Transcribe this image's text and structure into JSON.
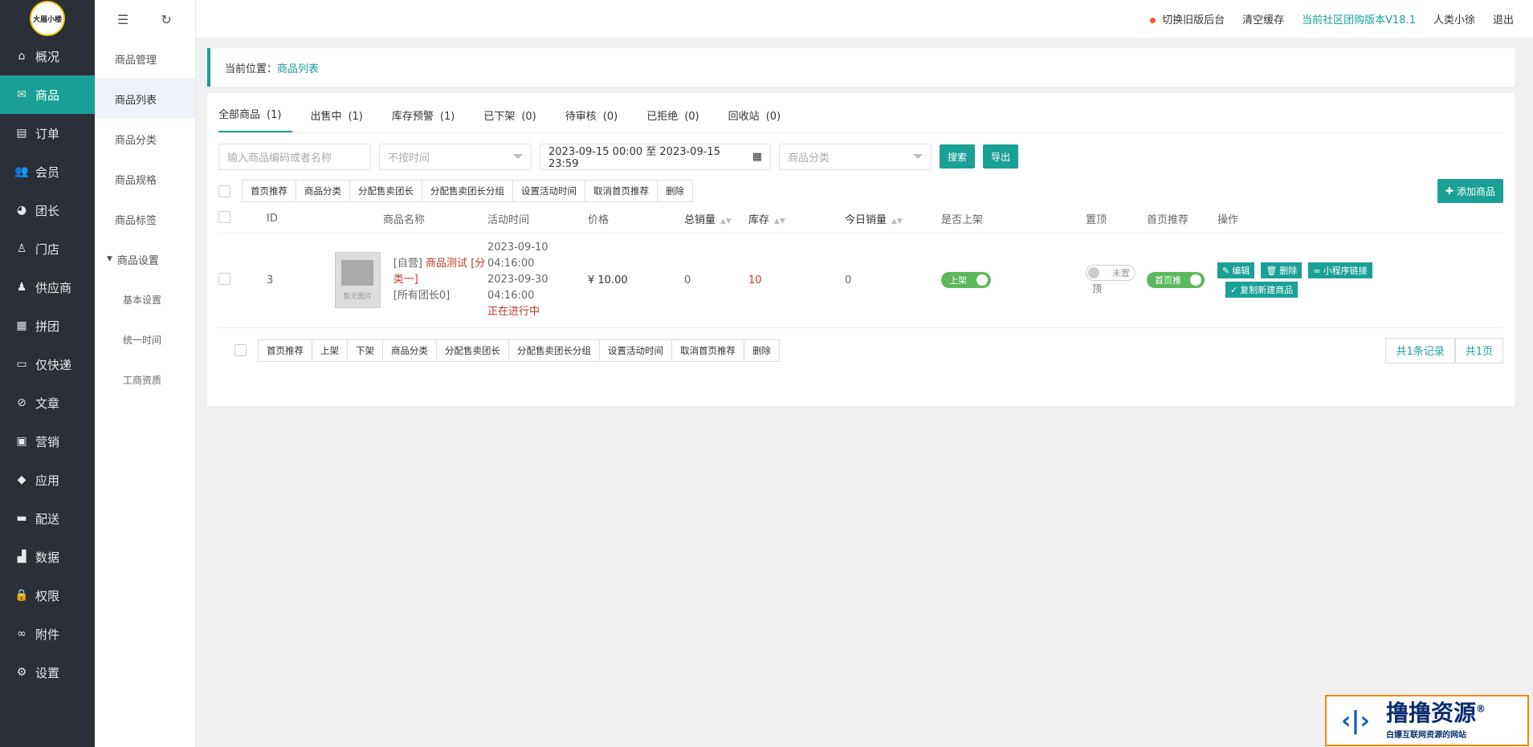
{
  "app": {
    "logo_text": "大眉小楼"
  },
  "sidebar": {
    "items": [
      {
        "label": "概况",
        "icon": "home-icon",
        "glyph": "⌂"
      },
      {
        "label": "商品",
        "icon": "goods-icon",
        "glyph": "✉"
      },
      {
        "label": "订单",
        "icon": "order-icon",
        "glyph": "▤"
      },
      {
        "label": "会员",
        "icon": "member-icon",
        "glyph": "👥"
      },
      {
        "label": "团长",
        "icon": "leader-icon",
        "glyph": "◕"
      },
      {
        "label": "门店",
        "icon": "store-icon",
        "glyph": "♙"
      },
      {
        "label": "供应商",
        "icon": "supplier-icon",
        "glyph": "♟"
      },
      {
        "label": "拼团",
        "icon": "group-buy-icon",
        "glyph": "▦"
      },
      {
        "label": "仅快递",
        "icon": "express-icon",
        "glyph": "▭"
      },
      {
        "label": "文章",
        "icon": "article-icon",
        "glyph": "⊘"
      },
      {
        "label": "营销",
        "icon": "gift-icon",
        "glyph": "▣"
      },
      {
        "label": "应用",
        "icon": "app-icon",
        "glyph": "◆"
      },
      {
        "label": "配送",
        "icon": "truck-icon",
        "glyph": "▬"
      },
      {
        "label": "数据",
        "icon": "data-icon",
        "glyph": "▟"
      },
      {
        "label": "权限",
        "icon": "lock-icon",
        "glyph": "🔒"
      },
      {
        "label": "附件",
        "icon": "link-icon",
        "glyph": "∞"
      },
      {
        "label": "设置",
        "icon": "gear-icon",
        "glyph": "⚙"
      }
    ]
  },
  "submenu": {
    "items": [
      {
        "label": "商品管理"
      },
      {
        "label": "商品列表"
      },
      {
        "label": "商品分类"
      },
      {
        "label": "商品规格"
      },
      {
        "label": "商品标签"
      },
      {
        "label": "商品设置"
      },
      {
        "label": "基本设置"
      },
      {
        "label": "统一时间"
      },
      {
        "label": "工商资质"
      }
    ]
  },
  "topbar": {
    "switch_old": "切换旧版后台",
    "clear_cache": "清空缓存",
    "version": "当前社区团购版本V18.1",
    "user": "人类小徐",
    "logout": "退出"
  },
  "breadcrumb": {
    "prefix": "当前位置：",
    "current": "商品列表"
  },
  "tabs": [
    {
      "label": "全部商品",
      "count": "(1)"
    },
    {
      "label": "出售中",
      "count": "(1)"
    },
    {
      "label": "库存预警",
      "count": "(1)"
    },
    {
      "label": "已下架",
      "count": "(0)"
    },
    {
      "label": "待审核",
      "count": "(0)"
    },
    {
      "label": "已拒绝",
      "count": "(0)"
    },
    {
      "label": "回收站",
      "count": "(0)"
    }
  ],
  "filters": {
    "keyword_placeholder": "输入商品编码或者名称",
    "time_type": "不按时间",
    "date_range": "2023-09-15 00:00 至 2023-09-15 23:59",
    "category_placeholder": "商品分类",
    "search": "搜索",
    "export": "导出"
  },
  "batch_top": [
    "首页推荐",
    "商品分类",
    "分配售卖团长",
    "分配售卖团长分组",
    "设置活动时间",
    "取消首页推荐",
    "删除"
  ],
  "batch_bottom": [
    "首页推荐",
    "上架",
    "下架",
    "商品分类",
    "分配售卖团长",
    "分配售卖团长分组",
    "设置活动时间",
    "取消首页推荐",
    "删除"
  ],
  "add_product": "添加商品",
  "table": {
    "headers": {
      "id": "ID",
      "name": "商品名称",
      "time": "活动时间",
      "price": "价格",
      "total_sales": "总销量",
      "stock": "库存",
      "today_sales": "今日销量",
      "on_shelf": "是否上架",
      "top": "置顶",
      "home": "首页推荐",
      "ops": "操作"
    },
    "rows": [
      {
        "id": "3",
        "thumb_text": "暂无图片",
        "tag": "[自营]",
        "name": "商品测试",
        "category": "[分类一]",
        "leaders": "[所有团长0]",
        "start_date": "2023-09-10",
        "start_time": "04:16:00",
        "end_date": "2023-09-30",
        "end_time": "04:16:00",
        "status": "正在进行中",
        "price": "¥ 10.00",
        "total_sales": "0",
        "stock": "10",
        "today_sales": "0",
        "on_shelf": "上架",
        "top_label": "未置",
        "top_label_2": "顶",
        "home": "首页推",
        "ops": {
          "edit": "编辑",
          "delete": "删除",
          "mini_link": "小程序链接",
          "copy": "复制新建商品"
        }
      }
    ]
  },
  "pager": {
    "total": "共1条记录",
    "pages": "共1页"
  },
  "watermark": {
    "title": "撸撸资源",
    "subtitle": "白嫖互联网资源的网站",
    "mark": "®"
  }
}
